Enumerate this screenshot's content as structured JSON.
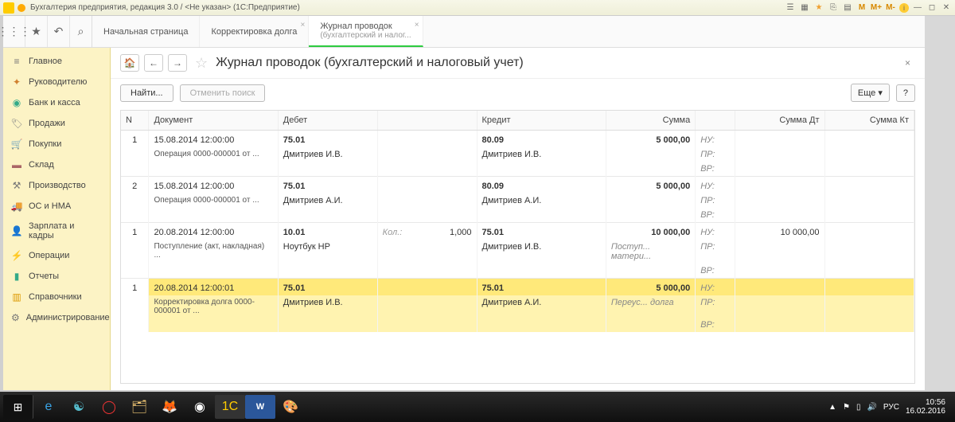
{
  "window": {
    "title": "Бухгалтерия предприятия, редакция 3.0 / <Не указан>  (1С:Предприятие)"
  },
  "sysbtns": [
    "☰",
    "▦",
    "☆",
    "⎘",
    "▤",
    "M",
    "M+",
    "M-"
  ],
  "topbar_icons": [
    "⋮⋮⋮",
    "★",
    "↶",
    "⏱"
  ],
  "tabs": [
    {
      "label": "Начальная страница",
      "sub": ""
    },
    {
      "label": "Корректировка долга",
      "sub": ""
    },
    {
      "label": "Журнал проводок",
      "sub": "(бухгалтерский и налог...",
      "active": true
    }
  ],
  "sidebar": [
    {
      "icon": "≡",
      "label": "Главное"
    },
    {
      "icon": "📈",
      "label": "Руководителю"
    },
    {
      "icon": "💰",
      "label": "Банк и касса"
    },
    {
      "icon": "🏷",
      "label": "Продажи"
    },
    {
      "icon": "🛒",
      "label": "Покупки"
    },
    {
      "icon": "🏢",
      "label": "Склад"
    },
    {
      "icon": "🏭",
      "label": "Производство"
    },
    {
      "icon": "🚚",
      "label": "ОС и НМА"
    },
    {
      "icon": "👤",
      "label": "Зарплата и кадры"
    },
    {
      "icon": "⚙",
      "label": "Операции"
    },
    {
      "icon": "📊",
      "label": "Отчеты"
    },
    {
      "icon": "📘",
      "label": "Справочники"
    },
    {
      "icon": "🔧",
      "label": "Администрирование"
    }
  ],
  "page": {
    "title": "Журнал проводок (бухгалтерский и налоговый учет)",
    "find": "Найти...",
    "cancel_find": "Отменить поиск",
    "more": "Еще ▾",
    "help": "?"
  },
  "columns": [
    "N",
    "Документ",
    "Дебет",
    "",
    "Кредит",
    "Сумма",
    "",
    "Сумма Дт",
    "Сумма Кт"
  ],
  "rows": [
    {
      "n": "1",
      "doc": "15.08.2014 12:00:00",
      "doc2": "Операция 0000-000001 от ...",
      "debit": "75.01",
      "debit2": "Дмитриев И.В.",
      "kol": "",
      "kolv": "",
      "credit": "80.09",
      "credit2": "Дмитриев И.В.",
      "sum": "5 000,00",
      "sum2": "",
      "nu": "НУ:",
      "pr": "ПР:",
      "vr": "ВР:",
      "sdt": "",
      "skt": ""
    },
    {
      "n": "2",
      "doc": "15.08.2014 12:00:00",
      "doc2": "Операция 0000-000001 от ...",
      "debit": "75.01",
      "debit2": "Дмитриев А.И.",
      "kol": "",
      "kolv": "",
      "credit": "80.09",
      "credit2": "Дмитриев А.И.",
      "sum": "5 000,00",
      "sum2": "",
      "nu": "НУ:",
      "pr": "ПР:",
      "vr": "ВР:",
      "sdt": "",
      "skt": ""
    },
    {
      "n": "1",
      "doc": "20.08.2014 12:00:00",
      "doc2": "Поступление (акт, накладная) ...",
      "debit": "10.01",
      "debit2": "Ноутбук HP",
      "kol": "Кол.:",
      "kolv": "1,000",
      "credit": "75.01",
      "credit2": "Дмитриев И.В.",
      "sum": "10 000,00",
      "sum2": "Поступ... матери...",
      "nu": "НУ:",
      "pr": "ПР:",
      "vr": "ВР:",
      "sdt": "10 000,00",
      "skt": ""
    },
    {
      "n": "1",
      "doc": "20.08.2014 12:00:01",
      "doc2": "Корректировка долга 0000-000001 от ...",
      "debit": "75.01",
      "debit2": "Дмитриев И.В.",
      "kol": "",
      "kolv": "",
      "credit": "75.01",
      "credit2": "Дмитриев А.И.",
      "sum": "5 000,00",
      "sum2": "Переус... долга",
      "nu": "НУ:",
      "pr": "ПР:",
      "vr": "ВР:",
      "sdt": "",
      "skt": "",
      "selected": true
    }
  ],
  "taskbar": {
    "tray_lang": "РУС",
    "time": "10:56",
    "date": "16.02.2016"
  }
}
